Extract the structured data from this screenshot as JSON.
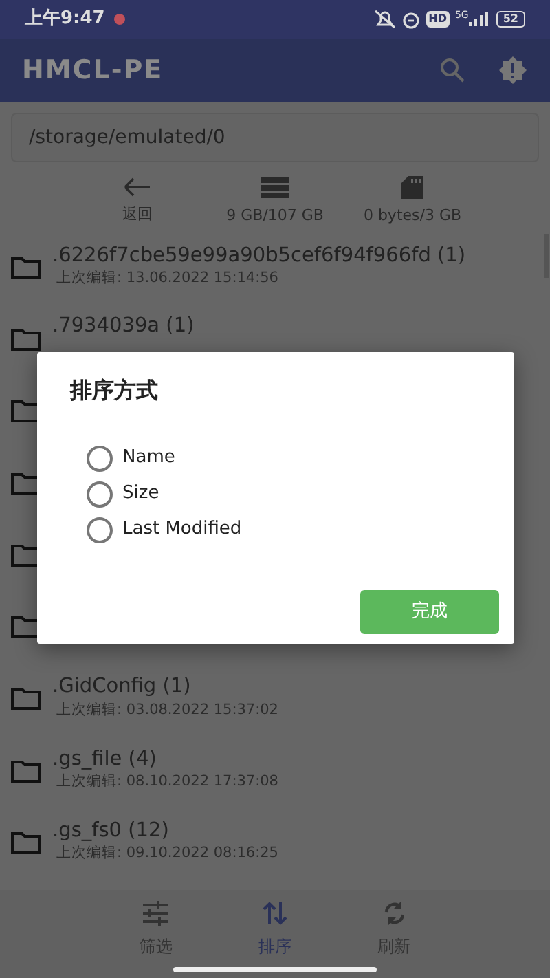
{
  "status_bar": {
    "time": "上午9:47",
    "hd": "HD",
    "network": "5G",
    "battery": "52"
  },
  "app_bar": {
    "title": "HMCL-PE"
  },
  "path_field": {
    "value": "/storage/emulated/0"
  },
  "toolbar": [
    {
      "kind": "back",
      "label": "返回"
    },
    {
      "kind": "storage",
      "label": "9 GB/107 GB"
    },
    {
      "kind": "sdcard",
      "label": "0 bytes/3 GB"
    }
  ],
  "files": [
    {
      "kind": "folder",
      "name": ".6226f7cbe59e99a90b5cef6f94f966fd (1)",
      "modified": "上次编辑: 13.06.2022 15:14:56"
    },
    {
      "kind": "folder",
      "name": ".7934039a (1)"
    },
    {
      "kind": "folder"
    },
    {
      "kind": "folder"
    },
    {
      "kind": "folder"
    },
    {
      "kind": "folder"
    },
    {
      "kind": "folder",
      "name": ".GidConfig (1)",
      "modified": "上次编辑: 03.08.2022 15:37:02"
    },
    {
      "kind": "folder",
      "name": ".gs_file (4)",
      "modified": "上次编辑: 08.10.2022 17:37:08"
    },
    {
      "kind": "folder",
      "name": ".gs_fs0 (12)",
      "modified": "上次编辑: 09.10.2022 08:16:25"
    }
  ],
  "dialog": {
    "title": "排序方式",
    "options": [
      {
        "label": "Name",
        "selected": false
      },
      {
        "label": "Size",
        "selected": false
      },
      {
        "label": "Last Modified",
        "selected": false
      }
    ],
    "button": "完成"
  },
  "bottom_nav": [
    {
      "kind": "filter",
      "label": "筛选",
      "selected": false
    },
    {
      "kind": "sort",
      "label": "排序",
      "selected": true
    },
    {
      "kind": "refresh",
      "label": "刷新",
      "selected": false
    }
  ]
}
